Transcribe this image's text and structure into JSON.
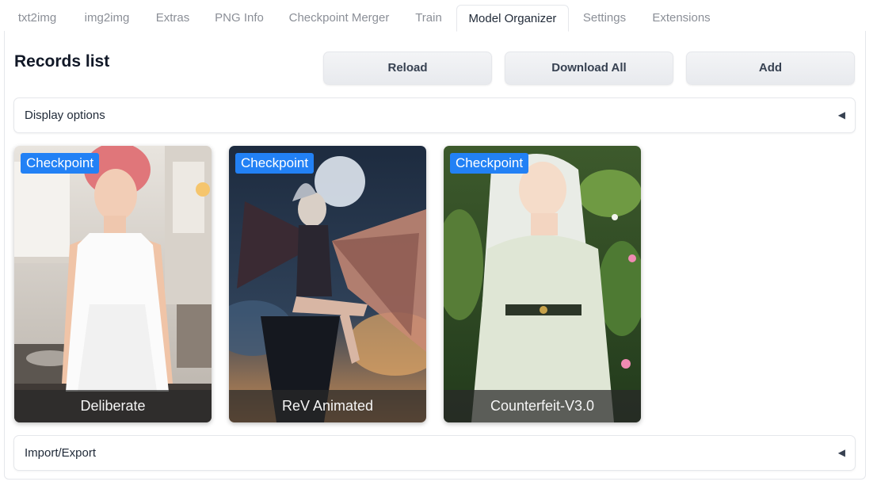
{
  "tabs": [
    {
      "label": "txt2img",
      "active": false
    },
    {
      "label": "img2img",
      "active": false
    },
    {
      "label": "Extras",
      "active": false
    },
    {
      "label": "PNG Info",
      "active": false
    },
    {
      "label": "Checkpoint Merger",
      "active": false
    },
    {
      "label": "Train",
      "active": false
    },
    {
      "label": "Model Organizer",
      "active": true
    },
    {
      "label": "Settings",
      "active": false
    },
    {
      "label": "Extensions",
      "active": false
    }
  ],
  "records": {
    "title": "Records list",
    "buttons": {
      "reload": "Reload",
      "download_all": "Download All",
      "add": "Add"
    },
    "display_options": "Display options",
    "import_export": "Import/Export",
    "collapse_glyph": "◀"
  },
  "cards": [
    {
      "badge": "Checkpoint",
      "name": "Deliberate"
    },
    {
      "badge": "Checkpoint",
      "name": "ReV Animated"
    },
    {
      "badge": "Checkpoint",
      "name": "Counterfeit-V3.0"
    }
  ],
  "colors": {
    "badge": "#2281f5",
    "active_tab_text": "#1f2937",
    "inactive_tab_text": "#8b8f97"
  }
}
